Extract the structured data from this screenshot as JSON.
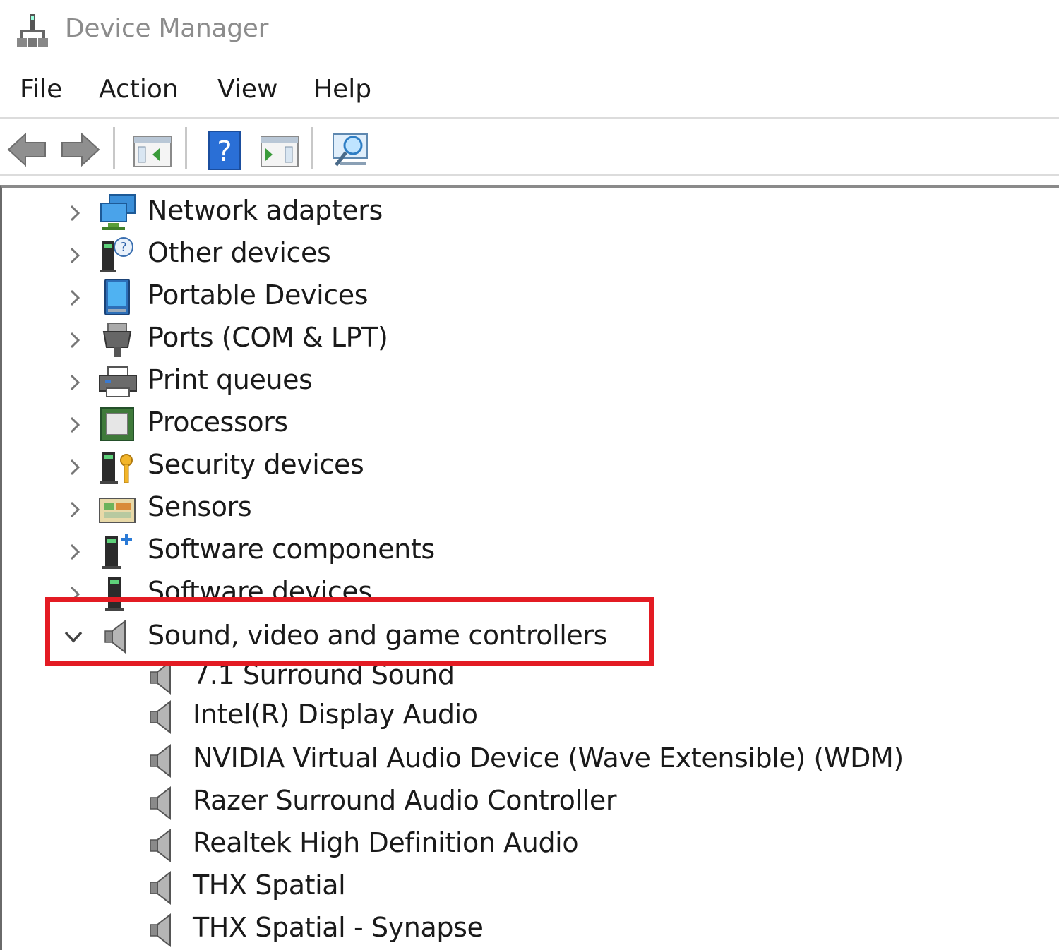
{
  "window": {
    "title": "Device Manager"
  },
  "menu": {
    "file": "File",
    "action": "Action",
    "view": "View",
    "help": "Help"
  },
  "toolbar": {
    "buttons": [
      "back-arrow-icon",
      "forward-arrow-icon",
      "show-hide-console-tree-icon",
      "help-icon",
      "properties-icon",
      "scan-hardware-changes-icon"
    ]
  },
  "tree": {
    "categories": [
      {
        "label": "Network adapters",
        "icon": "network-adapter-icon",
        "expanded": false
      },
      {
        "label": "Other devices",
        "icon": "other-devices-icon",
        "expanded": false
      },
      {
        "label": "Portable Devices",
        "icon": "portable-device-icon",
        "expanded": false
      },
      {
        "label": "Ports (COM & LPT)",
        "icon": "port-icon",
        "expanded": false
      },
      {
        "label": "Print queues",
        "icon": "printer-icon",
        "expanded": false
      },
      {
        "label": "Processors",
        "icon": "processor-icon",
        "expanded": false
      },
      {
        "label": "Security devices",
        "icon": "security-device-icon",
        "expanded": false
      },
      {
        "label": "Sensors",
        "icon": "sensor-icon",
        "expanded": false
      },
      {
        "label": "Software components",
        "icon": "software-component-icon",
        "expanded": false
      },
      {
        "label": "Software devices",
        "icon": "software-device-icon",
        "expanded": false
      },
      {
        "label": "Sound, video and game controllers",
        "icon": "speaker-icon",
        "expanded": true,
        "highlighted": true
      }
    ],
    "children": [
      "7.1 Surround Sound",
      "Intel(R) Display Audio",
      "NVIDIA Virtual Audio Device (Wave Extensible) (WDM)",
      "Razer Surround Audio Controller",
      "Realtek High Definition Audio",
      "THX Spatial",
      "THX Spatial - Synapse"
    ]
  },
  "colors": {
    "highlight_border": "#e31b23",
    "title_text": "#8c8c8c"
  }
}
